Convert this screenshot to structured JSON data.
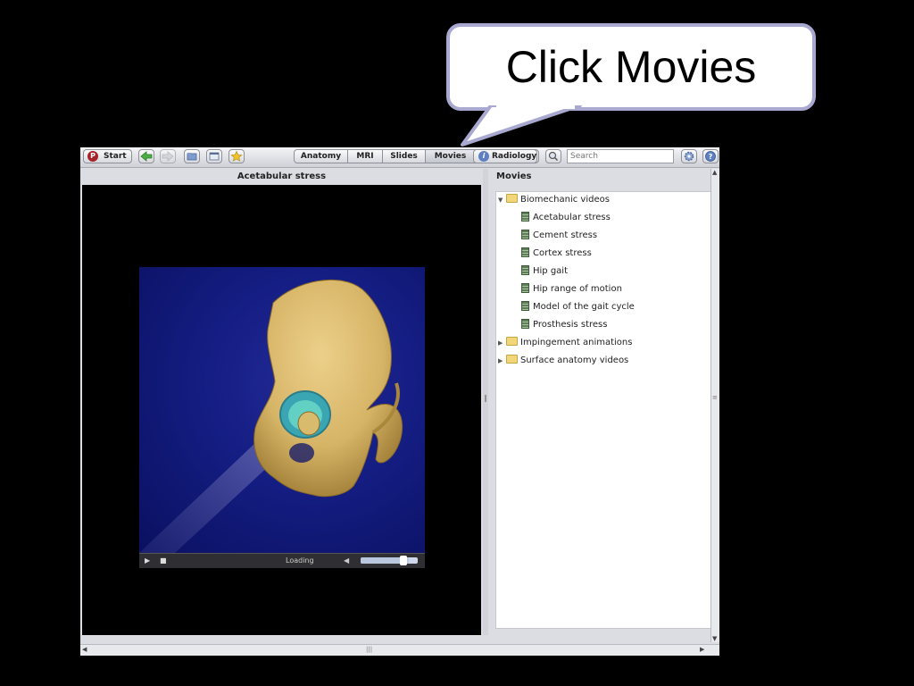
{
  "callout": {
    "text": "Click Movies"
  },
  "toolbar": {
    "start_label": "Start",
    "start_logo": "P",
    "icons": [
      "back-arrow-icon",
      "forward-arrow-icon",
      "folder-icon",
      "window-icon",
      "star-icon"
    ],
    "tabs": [
      {
        "label": "Anatomy",
        "active": false
      },
      {
        "label": "MRI",
        "active": false
      },
      {
        "label": "Slides",
        "active": false
      },
      {
        "label": "Movies",
        "active": true
      }
    ],
    "radiology_label": "Radiology",
    "search_placeholder": "Search"
  },
  "viewer": {
    "title": "Acetabular stress",
    "status": "Loading",
    "volume_level": 0.85
  },
  "panel": {
    "title": "Movies",
    "tree": [
      {
        "label": "Biomechanic videos",
        "expanded": true,
        "children": [
          "Acetabular stress",
          "Cement stress",
          "Cortex stress",
          "Hip gait",
          "Hip range of motion",
          "Model of the gait cycle",
          "Prosthesis stress"
        ]
      },
      {
        "label": "Impingement animations",
        "expanded": false,
        "children": []
      },
      {
        "label": "Surface anatomy videos",
        "expanded": false,
        "children": []
      }
    ]
  },
  "colors": {
    "background": "#000000",
    "bubble_border": "#a8a8d0",
    "video_background": "#141d82",
    "bone": "#d6b466",
    "cup": "#49b8b3"
  }
}
